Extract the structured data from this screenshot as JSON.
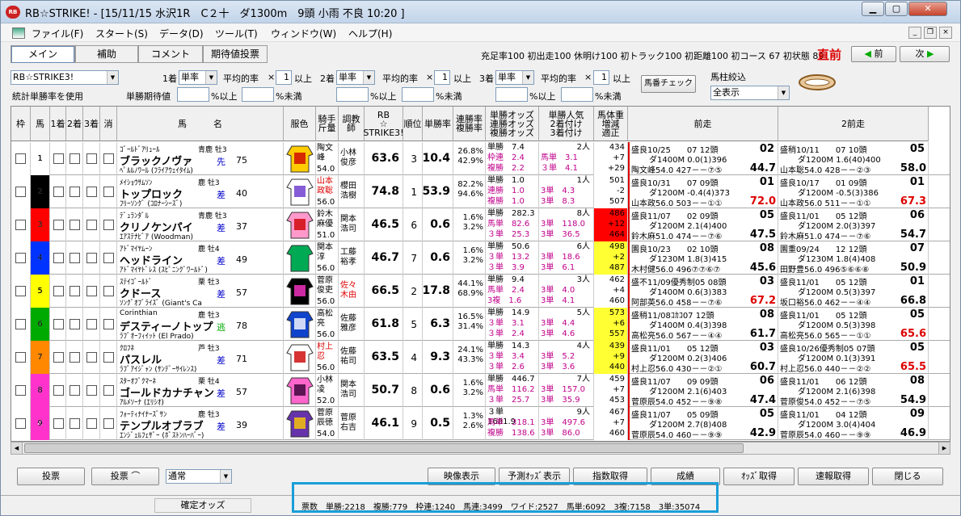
{
  "window": {
    "title": "RB☆STRIKE! - [15/11/15 水沢1R　C２十　ダ1300m　9頭 小雨 不良 10:20 ]",
    "icon": "RB"
  },
  "menu": [
    "ファイル(F)",
    "スタート(S)",
    "データ(D)",
    "ツール(T)",
    "ウィンドウ(W)",
    "ヘルプ(H)"
  ],
  "tabs": [
    "メイン",
    "補助",
    "コメント",
    "期待値投票"
  ],
  "stats_line": "充足率100 初出走100 休明け100 初トラック100 初距離100 初コース 67 初状態 89",
  "direct_label": "直前",
  "nav": {
    "prev": "前",
    "next": "次"
  },
  "filters": {
    "mode": "RB☆STRIKE3!",
    "stat_label": "統計単勝率を使用",
    "place1": "1着",
    "place2": "2着",
    "place3": "3着",
    "rate_type": "単率",
    "avg_label": "平均的率",
    "times": "×",
    "ijou": "以上",
    "value": "1",
    "tan_kitai": "単勝期待値",
    "pct_ijou": "%以上",
    "pct_miman": "%未満",
    "umaban_btn": "馬番チェック",
    "umabashira": "馬柱絞込",
    "display": "全表示"
  },
  "headers": [
    "枠",
    "馬",
    "1着",
    "2着",
    "3着",
    "消",
    "馬　　　名",
    "服色",
    "騎手\n斤量",
    "調教\n師",
    "RB\n☆\nSTRIKE3!",
    "順位",
    "単勝率",
    "連勝率\n複勝率",
    "単勝オッズ\n連勝オッズ\n複勝オッズ",
    "単勝人気\n2着付け\n3着付け",
    "馬体重\n増減\n適正",
    "前走",
    "2前走"
  ],
  "horses": [
    {
      "waku": "1",
      "uma": "1",
      "sire": "ｺﾞｰﾙﾄﾞｱﾘｭｰﾙ",
      "sexage": "青鹿 牡3",
      "name": "ブラックノヴァ",
      "dam": "ﾍﾟﾙﾙﾉﾜｰﾙ (ﾌﾗｲｱｳｪｲﾀｲﾑ)",
      "kyaku": "先",
      "ninki": "75",
      "jockey": "陶文\n峰",
      "kinryo": "54.0",
      "trainer": "小林\n俊彦",
      "rb": "63.6",
      "rank": "3",
      "tan": "10.4",
      "ren": "26.8%",
      "fuku": "42.9%",
      "odds_t": "単勝　7.4",
      "odds_r": "枠連　2.4",
      "odds_f": "複勝　2.2",
      "pop": "2人",
      "pop2": "馬単　3.1",
      "pop3": "３単　4.1",
      "wt": "434",
      "wt2": "+7",
      "wt3": "+29",
      "p1a": "盛良10/25　　07 12頭",
      "p1pos": "02",
      "p1b": "ダ1400M 0.0(1)396",
      "p1c": "陶文峰54.0 427－－⑦⑤",
      "p1n": "44.7",
      "p2a": "盛稍10/11　　07 10頭",
      "p2pos": "05",
      "p2b": "ダ1200M 1.6(40)400",
      "p2c": "山本聡54.0 428－－②③",
      "p2n": "58.0"
    },
    {
      "waku": "2",
      "uma": "2",
      "sire": "ﾒｲｼｮｳｻﾑｿﾝ",
      "sexage": "鹿 牡3",
      "name": "トップロック",
      "dam": "ﾌﾘｰｿﾝｸﾞ (ｺﾛﾅｰｼｰｽﾞ)",
      "kyaku": "差",
      "ninki": "40",
      "jockey": "山本\n政聡",
      "kinryo": "56.0",
      "trainer": "櫻田\n浩樹",
      "rb": "74.8",
      "rank": "1",
      "tan": "53.9",
      "ren": "82.2%",
      "fuku": "94.6%",
      "odds_t": "単勝　1.0",
      "odds_r": "連勝　1.0",
      "odds_f": "複勝　1.0",
      "pop": "1人",
      "pop2": "3単　4.3",
      "pop3": "3単　8.3",
      "wt": "501",
      "wt2": "-2",
      "wt3": "507",
      "p1a": "盛良10/31　　07 09頭",
      "p1pos": "01",
      "p1b": "ダ1200M -0.4(4)373",
      "p1c": "山本政56.0 503－－①①",
      "p1n": "72.0",
      "p2a": "盛良10/17　　01 09頭",
      "p2pos": "01",
      "p2b": "ダ1200M -0.5(3)386",
      "p2c": "山本政56.0 511－－①①",
      "p2n": "67.3"
    },
    {
      "waku": "3",
      "uma": "3",
      "sire": "ﾃﾞｭﾗﾝﾀﾞﾙ",
      "sexage": "青鹿 牡3",
      "name": "クリノケンパイ",
      "dam": "ｴｱｽﾃﾅﾋﾞｱ (Woodman)",
      "kyaku": "差",
      "ninki": "37",
      "jockey": "鈴木\n麻優",
      "kinryo": "51.0",
      "trainer": "関本\n浩司",
      "rb": "46.5",
      "rank": "6",
      "tan": "0.6",
      "ren": "1.6%",
      "fuku": "3.2%",
      "odds_t": "単勝　282.3",
      "odds_r": "馬単　82.6",
      "odds_f": "３単　25.3",
      "pop": "8人",
      "pop2": "3単　118.0",
      "pop3": "3単　36.5",
      "wt": "486",
      "wt2": "+12",
      "wt3": "464",
      "p1a": "盛良11/07　　02 09頭",
      "p1pos": "05",
      "p1b": "ダ1200M 2.1(4)400",
      "p1c": "鈴木麻51.0 474－－⑦⑥",
      "p1n": "47.5",
      "p2a": "盛良11/01　　05 12頭",
      "p2pos": "06",
      "p2b": "ダ1200M 2.0(3)397",
      "p2c": "鈴木麻51.0 474－－⑦⑥",
      "p2n": "54.7"
    },
    {
      "waku": "4",
      "uma": "4",
      "sire": "ｱﾄﾞﾏｲﾔﾑｰﾝ",
      "sexage": "鹿 牡4",
      "name": "ヘッドライン",
      "dam": "ｱﾄﾞﾏｲﾔﾄﾞﾚｽ (ｽﾋﾟﾆﾝｸﾞﾜｰﾙﾄﾞ)",
      "kyaku": "差",
      "ninki": "49",
      "jockey": "関本\n淳",
      "kinryo": "56.0",
      "trainer": "工藤\n裕孝",
      "rb": "46.7",
      "rank": "7",
      "tan": "0.6",
      "ren": "1.6%",
      "fuku": "3.2%",
      "odds_t": "単勝　50.6",
      "odds_r": "３単　13.2",
      "odds_f": "３単　3.9",
      "pop": "6人",
      "pop2": "3単　18.6",
      "pop3": "3単　6.1",
      "wt": "498",
      "wt2": "+2",
      "wt3": "487",
      "p1a": "園良10/23　　02 10頭",
      "p1pos": "08",
      "p1b": "ダ1230M 1.8(3)415",
      "p1c": "木村健56.0 496⑦⑦⑥⑦",
      "p1n": "45.6",
      "p2a": "園重09/24　　12 12頭",
      "p2pos": "07",
      "p2b": "ダ1230M 1.8(4)408",
      "p2c": "田野豊56.0 496⑤⑥⑥⑧",
      "p2n": "50.9"
    },
    {
      "waku": "5",
      "uma": "5",
      "sire": "ｽﾃｲｺﾞｰﾙﾄﾞ",
      "sexage": "栗 牡3",
      "name": "クドース",
      "dam": "ｿﾝｸﾞｵﾌﾞﾗｲｽﾞ (Giant's Ca",
      "kyaku": "差",
      "ninki": "57",
      "jockey": "菅原\n俊吏",
      "kinryo": "56.0",
      "trainer": "佐々\n木由",
      "rb": "66.5",
      "rank": "2",
      "tan": "17.8",
      "ren": "44.1%",
      "fuku": "68.9%",
      "odds_t": "単勝　9.4",
      "odds_r": "馬単　2.4",
      "odds_f": "3複　1.6",
      "pop": "3人",
      "pop2": "3単　4.0",
      "pop3": "3単　4.1",
      "wt": "462",
      "wt2": "+4",
      "wt3": "460",
      "p1a": "盛不11/09優秀制05 08頭",
      "p1pos": "03",
      "p1b": "ダ1400M 0.6(3)383",
      "p1c": "阿部英56.0 458－－⑦⑥",
      "p1n": "67.2",
      "p2a": "盛良11/01　　05 12頭",
      "p2pos": "01",
      "p2b": "ダ1200M 0.5(3)397",
      "p2c": "坂口裕56.0 462－－④④",
      "p2n": "66.8"
    },
    {
      "waku": "6",
      "uma": "6",
      "sire": "Corinthian",
      "sexage": "鹿 牡3",
      "name": "デスティーノトップ",
      "dam": "ﾗﾌﾞｵｰﾌｨｲｯﾄ (El Prado)",
      "kyaku": "逃",
      "ninki": "78",
      "jockey": "高松\n亮",
      "kinryo": "56.0",
      "trainer": "佐藤\n雅彦",
      "rb": "61.8",
      "rank": "5",
      "tan": "6.3",
      "ren": "16.5%",
      "fuku": "31.4%",
      "odds_t": "単勝　14.9",
      "odds_r": "３単　3.1",
      "odds_f": "３単　2.4",
      "pop": "5人",
      "pop2": "3単　4.4",
      "pop3": "3単　4.6",
      "wt": "573",
      "wt2": "+6",
      "wt3": "557",
      "p1a": "盛稍11/08ｺｶｺ07 12頭",
      "p1pos": "08",
      "p1b": "ダ1400M 0.4(3)398",
      "p1c": "高松亮56.0 567－－④④",
      "p1n": "61.7",
      "p2a": "盛良11/01　　05 12頭",
      "p2pos": "05",
      "p2b": "ダ1200M 0.5(3)398",
      "p2c": "高松亮56.0 565－－①①",
      "p2n": "65.6"
    },
    {
      "waku": "7",
      "uma": "7",
      "sire": "ｸﾛﾌﾈ",
      "sexage": "芦 牡3",
      "name": "パスレル",
      "dam": "ﾗﾌﾞｱｲｼﾞｬﾝ (ｻﾝﾃﾞｰｻｲﾚﾝｽ)",
      "kyaku": "差",
      "ninki": "71",
      "jockey": "村上\n忍",
      "kinryo": "56.0",
      "trainer": "佐藤\n祐司",
      "rb": "63.5",
      "rank": "4",
      "tan": "9.3",
      "ren": "24.1%",
      "fuku": "43.3%",
      "odds_t": "単勝　14.3",
      "odds_r": "３単　3.4",
      "odds_f": "３単　2.6",
      "pop": "4人",
      "pop2": "3単　5.2",
      "pop3": "3単　3.6",
      "wt": "439",
      "wt2": "+9",
      "wt3": "440",
      "p1a": "盛良11/01　　05 12頭",
      "p1pos": "03",
      "p1b": "ダ1200M 0.2(3)406",
      "p1c": "村上忍56.0 430－－②①",
      "p1n": "60.7",
      "p2a": "盛良10/26優秀制05 07頭",
      "p2pos": "05",
      "p2b": "ダ1200M 0.1(3)391",
      "p2c": "村上忍56.0 440－－②②",
      "p2n": "65.5"
    },
    {
      "waku": "8",
      "uma": "8",
      "sire": "ｽﾀｰｵﾌﾞｸﾏｰﾈ",
      "sexage": "栗 牡4",
      "name": "ゴールドカナチャン",
      "dam": "ｱﾙﾒｿｰﾅ (ｴﾘｼｵ)",
      "kyaku": "差",
      "ninki": "57",
      "jockey": "小林\n凌",
      "kinryo": "52.0",
      "trainer": "関本\n浩司",
      "rb": "50.7",
      "rank": "8",
      "tan": "0.6",
      "ren": "1.6%",
      "fuku": "3.2%",
      "odds_t": "単勝　446.7",
      "odds_r": "馬単　116.2",
      "odds_f": "３単　25.7",
      "pop": "7人",
      "pop2": "3単　157.0",
      "pop3": "3単　35.9",
      "wt": "459",
      "wt2": "+7",
      "wt3": "453",
      "p1a": "盛良11/07　　09 09頭",
      "p1pos": "06",
      "p1b": "ダ1200M 2.1(6)403",
      "p1c": "菅原辰54.0 452－－⑨⑧",
      "p1n": "47.4",
      "p2a": "盛良11/01　　06 12頭",
      "p2pos": "08",
      "p2b": "ダ1200M 2.1(6)398",
      "p2c": "菅原俊54.0 452－－⑦⑤",
      "p2n": "54.9"
    },
    {
      "waku": "8",
      "uma": "9",
      "sire": "ﾌｫｰﾃｨﾅｲﾅｰｽﾞｻﾝ",
      "sexage": "鹿 牡3",
      "name": "テンプルオブラブ",
      "dam": "ｴﾝｼﾞｪﾙﾌｪｻﾞｰ (ﾎﾞｽﾄﾝﾊｰﾊﾞｰ)",
      "kyaku": "差",
      "ninki": "39",
      "jockey": "菅原\n辰徳",
      "kinryo": "54.0",
      "trainer": "菅原\n右吉",
      "rb": "46.1",
      "rank": "9",
      "tan": "0.5",
      "ren": "1.3%",
      "fuku": "2.6%",
      "odds_t": "３単　1681.9",
      "odds_r": "馬単　318.1",
      "odds_f": "複勝　138.6",
      "pop": "9人",
      "pop2": "3単　497.6",
      "pop3": "3単　86.0",
      "wt": "467",
      "wt2": "+7",
      "wt3": "460",
      "p1a": "盛良11/07　　05 09頭",
      "p1pos": "05",
      "p1b": "ダ1200M 2.7(8)408",
      "p1c": "菅原辰54.0 460－－⑨⑨",
      "p1n": "42.9",
      "p2a": "盛良11/01　　04 12頭",
      "p2pos": "09",
      "p2b": "ダ1200M 3.0(4)404",
      "p2c": "菅原辰54.0 460－－⑨⑨",
      "p2n": "46.9"
    }
  ],
  "bottom": {
    "bet": "投票",
    "bet2": "投票 ⌒",
    "mode": "通常",
    "video": "映像表示",
    "predict": "予測ｵｯｽﾞ表示",
    "index": "指数取得",
    "result": "成績",
    "odds": "ｵｯｽﾞ取得",
    "sokuho": "速報取得",
    "close": "閉じる"
  },
  "status": {
    "fixed": "確定オッズ",
    "votes": "票数　単勝:2218　複勝:779　枠連:1240　馬連:3499　ワイド:2527　馬単:6092　3複:7158　3単:35074"
  },
  "colors": {
    "waku": [
      "#ffffff",
      "#000000",
      "#ff0000",
      "#0033ff",
      "#ffff00",
      "#00aa00",
      "#ff8800",
      "#ff33cc",
      "#ff33cc"
    ]
  }
}
